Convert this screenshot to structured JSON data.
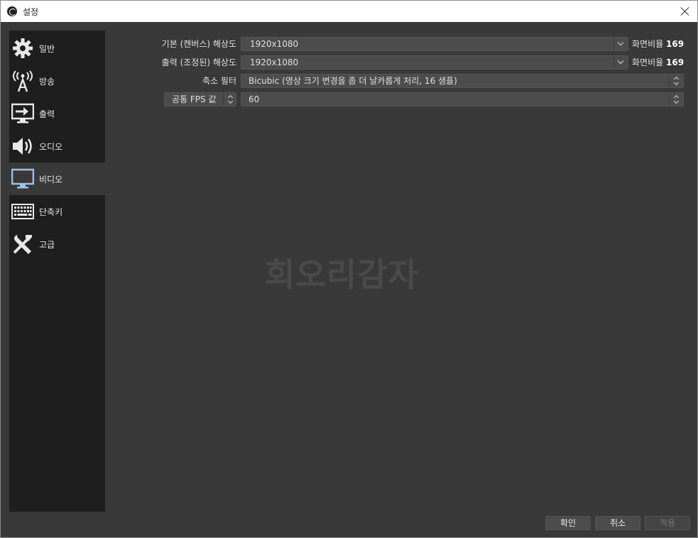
{
  "window": {
    "title": "설정"
  },
  "sidebar": {
    "items": [
      {
        "label": "일반",
        "icon": "gear-icon"
      },
      {
        "label": "방송",
        "icon": "broadcast-tower-icon"
      },
      {
        "label": "출력",
        "icon": "output-icon"
      },
      {
        "label": "오디오",
        "icon": "speaker-icon"
      },
      {
        "label": "비디오",
        "icon": "monitor-icon",
        "active": true
      },
      {
        "label": "단축키",
        "icon": "keyboard-icon"
      },
      {
        "label": "고급",
        "icon": "tools-icon"
      }
    ]
  },
  "video": {
    "base_resolution": {
      "label": "기본 (캔버스) 해상도",
      "value": "1920x1080",
      "ratio_label": "화면비율",
      "ratio_value": "169"
    },
    "output_resolution": {
      "label": "출력 (조정된) 해상도",
      "value": "1920x1080",
      "ratio_label": "화면비율",
      "ratio_value": "169"
    },
    "downscale_filter": {
      "label": "축소 필터",
      "value": "Bicubic (영상 크기 변경을 좀 더 날카롭게 처리, 16 샘플)"
    },
    "fps": {
      "type_label": "공통 FPS 값",
      "value": "60"
    }
  },
  "watermark": "회오리감자",
  "footer": {
    "ok_label": "확인",
    "cancel_label": "취소",
    "apply_label": "적용"
  },
  "colors": {
    "background": "#3a3939",
    "sidebar": "#1e1e1e",
    "control": "#4c4c4c",
    "icon": "#e8e8e8",
    "active_icon": "#9ec3e8"
  }
}
